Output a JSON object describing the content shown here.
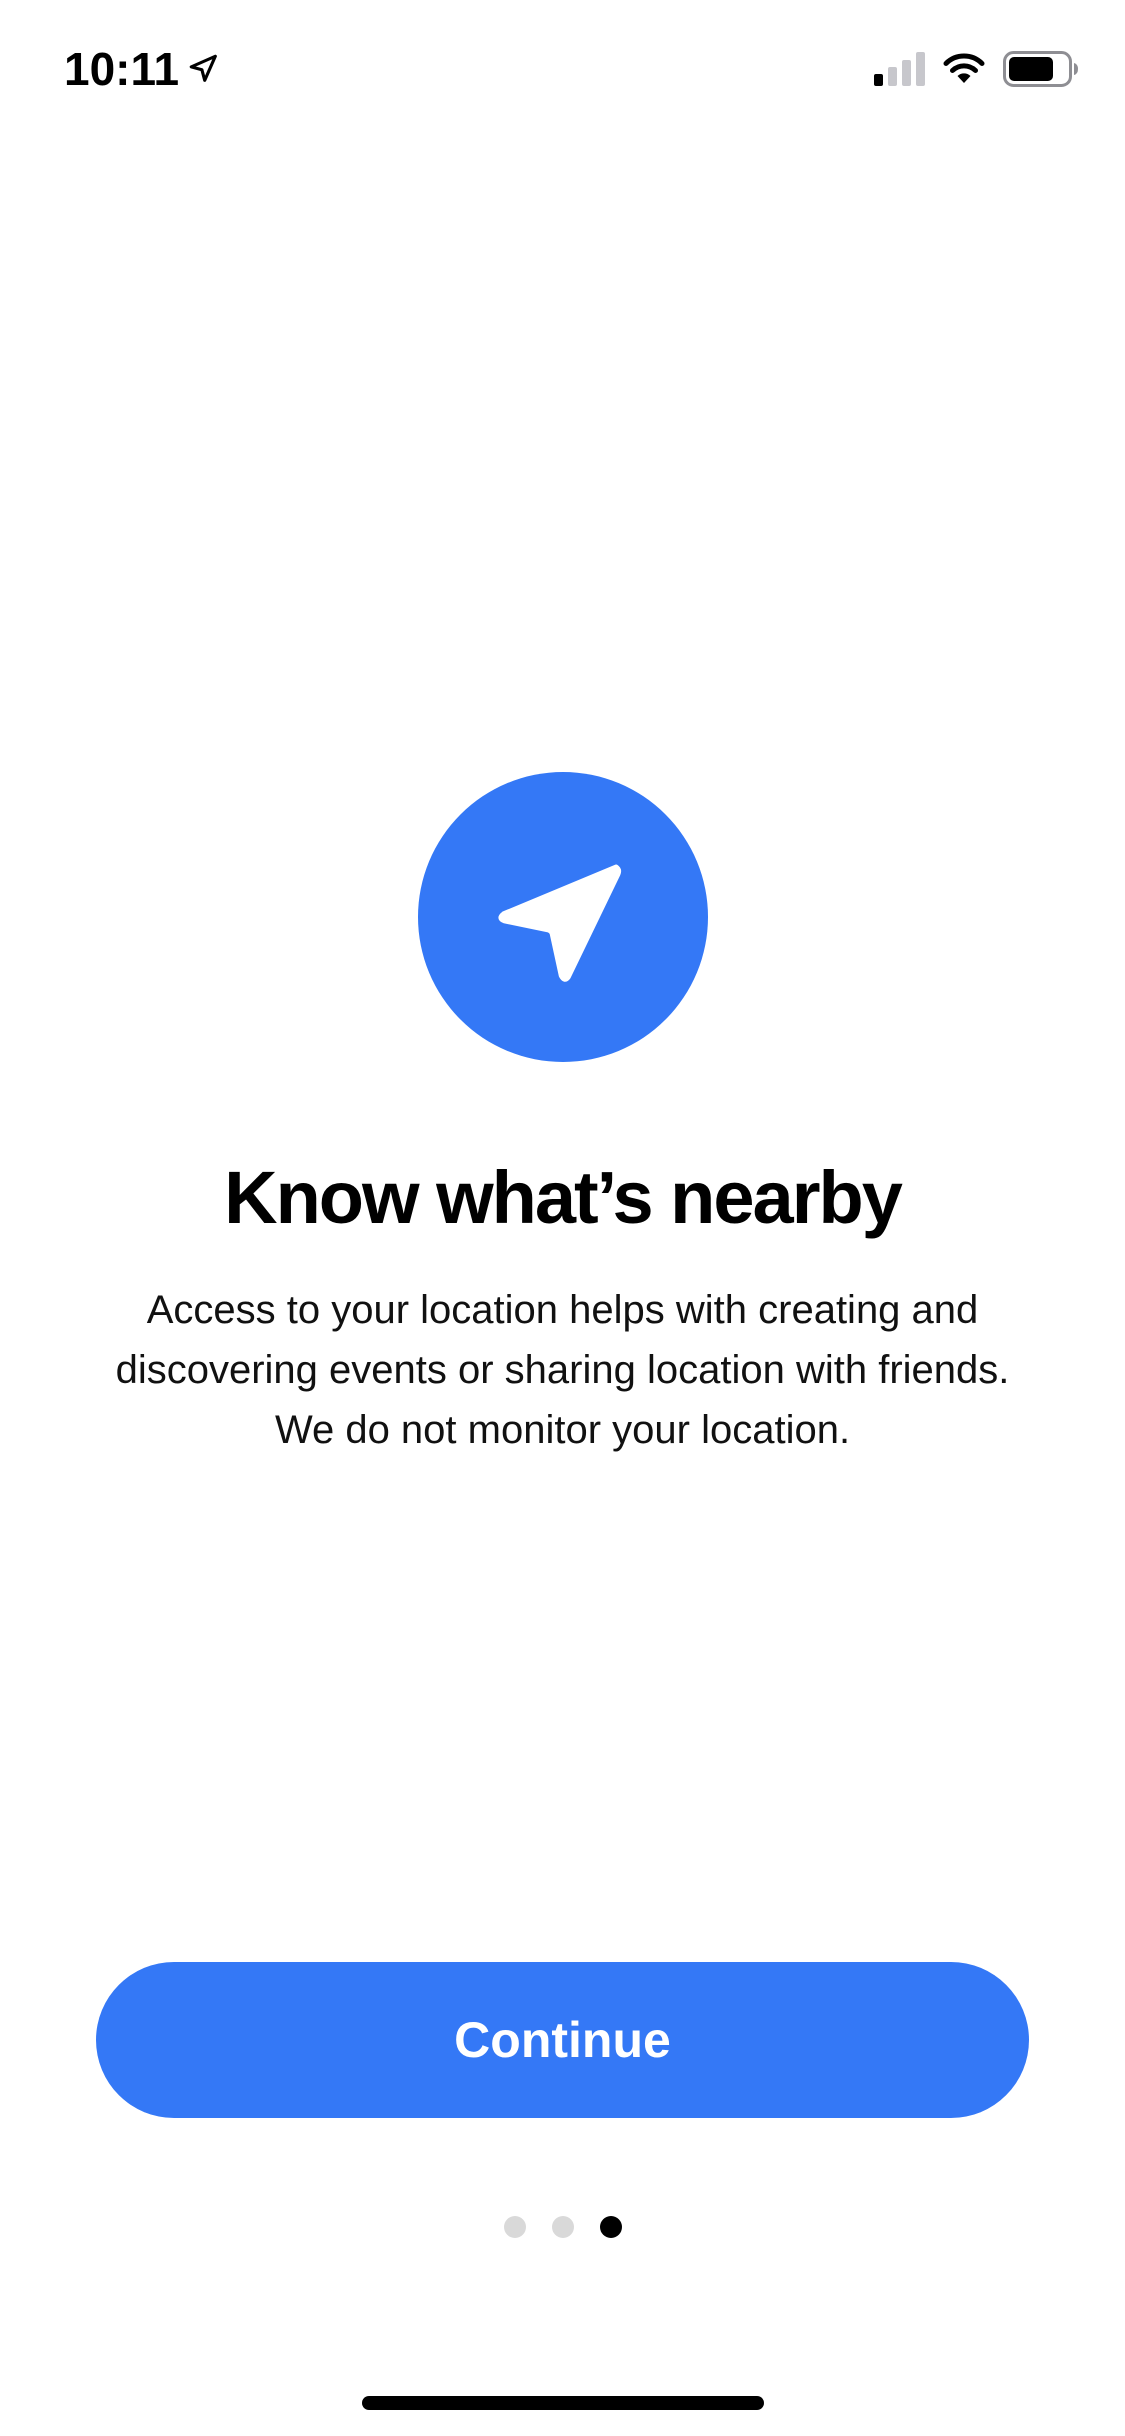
{
  "status_bar": {
    "time": "10:11",
    "location_icon": "location-arrow-icon",
    "signal_icon": "cellular-signal-icon",
    "signal_bars_active": 1,
    "signal_bars_total": 4,
    "wifi_icon": "wifi-icon",
    "battery_icon": "battery-icon",
    "battery_level": 0.75
  },
  "onboarding": {
    "hero_icon": "location-arrow-icon",
    "title": "Know what’s nearby",
    "description": "Access to your location helps with creating and discovering events or sharing location with friends. We do not monitor your location.",
    "continue_label": "Continue"
  },
  "pagination": {
    "total_pages": 3,
    "current_page": 3
  },
  "colors": {
    "accent": "#3478F6",
    "dot_inactive": "#D9D9D9",
    "dot_active": "#000000",
    "background": "#FFFFFF"
  }
}
